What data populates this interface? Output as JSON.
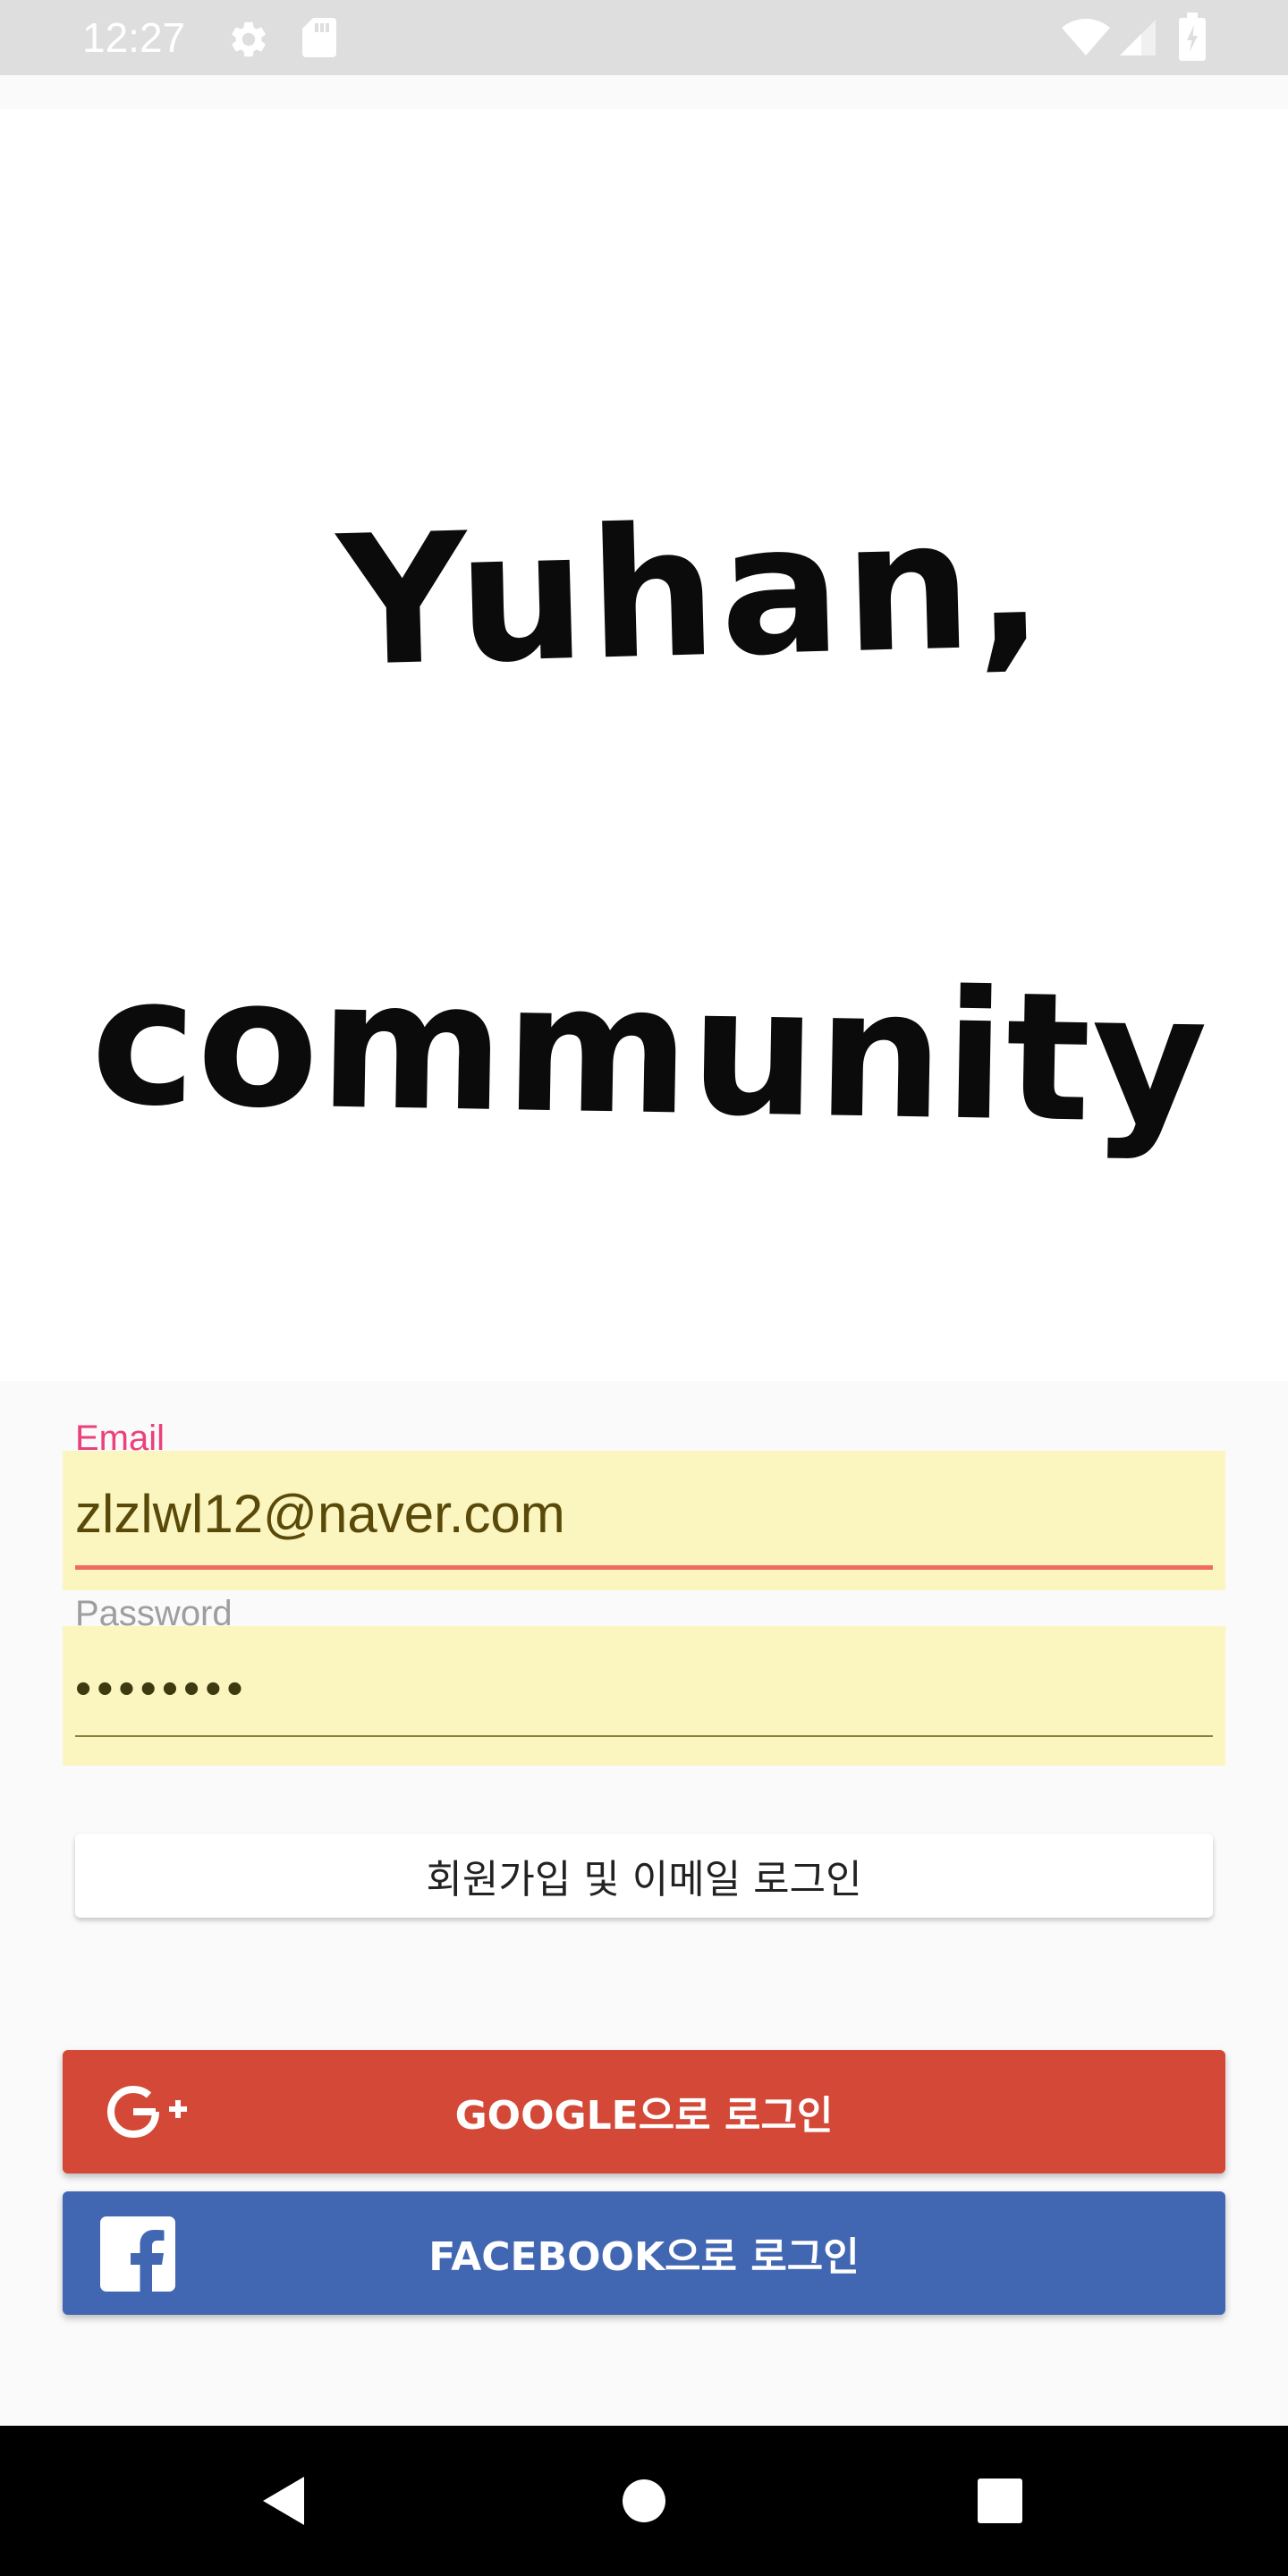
{
  "status_bar": {
    "time": "12:27",
    "icons": [
      "settings-icon",
      "sd-card-icon",
      "wifi-icon",
      "signal-icon",
      "battery-icon"
    ]
  },
  "logo": {
    "line1": "Yuhan,",
    "line2": "community"
  },
  "form": {
    "email": {
      "label": "Email",
      "value": "zlzlwl12@naver.com"
    },
    "password": {
      "label": "Password",
      "value": "••••••••"
    }
  },
  "buttons": {
    "signup_label": "회원가입 및 이메일 로그인",
    "google_label": "GOOGLE으로 로그인",
    "facebook_label": "FACEBOOK으로 로그인"
  },
  "nav_bar": {
    "icons": [
      "back-icon",
      "home-icon",
      "recents-icon"
    ]
  },
  "colors": {
    "field_background": "#fbf5c0",
    "email_label": "#ec407a",
    "email_underline": "#f16c5e",
    "google": "#d34836",
    "facebook": "#4267b2",
    "status_bar": "#dedede"
  }
}
